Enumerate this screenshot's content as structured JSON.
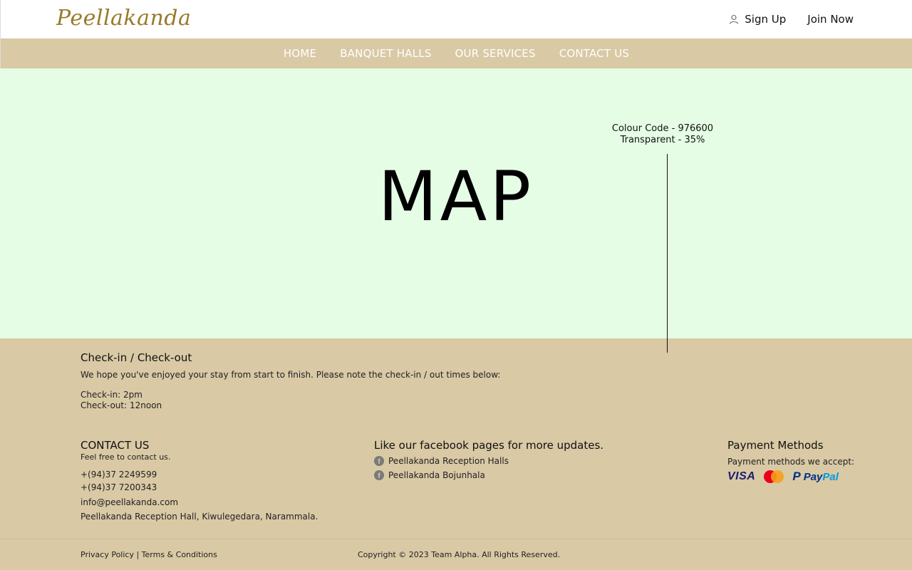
{
  "header": {
    "logo": "Peellakanda",
    "sign_up": "Sign Up",
    "join_now": "Join Now"
  },
  "nav": {
    "items": [
      "HOME",
      "BANQUET HALLS",
      "OUR SERVICES",
      "CONTACT US"
    ]
  },
  "map": {
    "title": "MAP",
    "note_line1": "Colour Code - 976600",
    "note_line2": "Transparent - 35%"
  },
  "checkin": {
    "title": "Check-in / Check-out",
    "description": "We hope you've enjoyed your stay from start to finish. Please note the check-in / out times below:",
    "checkin_time": "Check-in: 2pm",
    "checkout_time": "Check-out: 12noon"
  },
  "footer": {
    "contact": {
      "title": "CONTACT US",
      "subtitle": "Feel free to contact us.",
      "phone1": "+(94)37 2249599",
      "phone2": "+(94)37 7200343",
      "email": "info@peellakanda.com",
      "address": "Peellakanda Reception Hall, Kiwulegedara, Narammala."
    },
    "facebook": {
      "title": "Like our facebook pages for more updates.",
      "pages": [
        "Peellakanda Reception Halls",
        "Peellakanda Bojunhala"
      ]
    },
    "payment": {
      "title": "Payment Methods",
      "subtitle": "Payment methods we accept:",
      "visa": "VISA",
      "paypal_pay": "Pay",
      "paypal_pal": "Pal"
    }
  },
  "bottom": {
    "privacy": "Privacy Policy",
    "separator": " | ",
    "terms": "Terms & Conditions",
    "copyright": "Copyright © 2023 Team Alpha. All Rights Reserved."
  },
  "colors": {
    "brand_gold": "#9a7a2a",
    "nav_bg": "#d9c9a5",
    "map_bg": "#e5fde5"
  }
}
